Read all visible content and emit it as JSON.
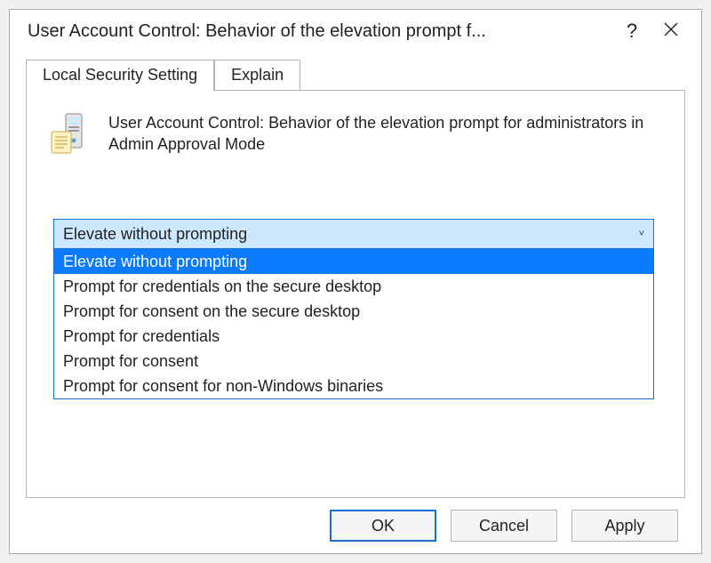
{
  "titlebar": {
    "title": "User Account Control: Behavior of the elevation prompt f...",
    "help_label": "?",
    "close_label": "Close"
  },
  "tabs": {
    "local_security": "Local Security Setting",
    "explain": "Explain"
  },
  "policy": {
    "description": "User Account Control: Behavior of the elevation prompt for administrators in Admin Approval Mode"
  },
  "dropdown": {
    "selected": "Elevate without prompting",
    "chevron": "˅",
    "options": [
      "Elevate without prompting",
      "Prompt for credentials on the secure desktop",
      "Prompt for consent on the secure desktop",
      "Prompt for credentials",
      "Prompt for consent",
      "Prompt for consent for non-Windows binaries"
    ],
    "highlighted_index": 0
  },
  "buttons": {
    "ok": "OK",
    "cancel": "Cancel",
    "apply": "Apply"
  }
}
